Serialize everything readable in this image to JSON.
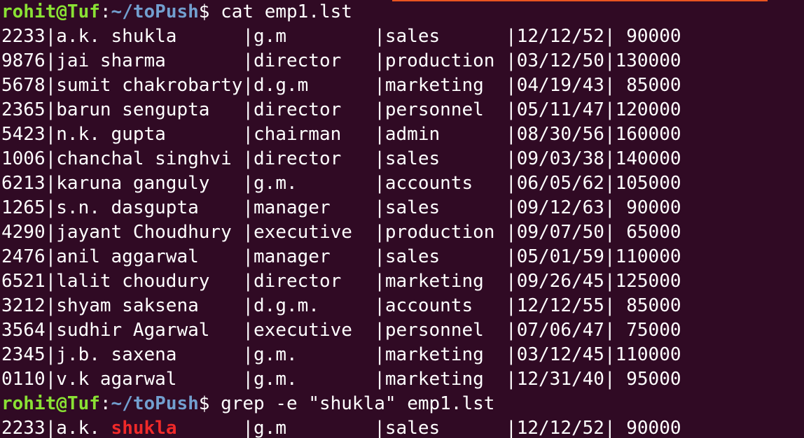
{
  "colors": {
    "background": "#300a24",
    "text": "#ffffff",
    "prompt_user": "#8ae234",
    "prompt_path": "#729fcf",
    "grep_match": "#ef2929",
    "top_accent": "#e95420"
  },
  "prompt": {
    "user_host": "rohit@Tuf",
    "separator": ":",
    "path": "~/toPush",
    "symbol": "$"
  },
  "commands": {
    "cat": " cat emp1.lst",
    "grep": " grep -e \"shukla\" emp1.lst"
  },
  "rows": [
    "2233|a.k. shukla      |g.m        |sales      |12/12/52| 90000",
    "9876|jai sharma       |director   |production |03/12/50|130000",
    "5678|sumit chakrobarty|d.g.m      |marketing  |04/19/43| 85000",
    "2365|barun sengupta   |director   |personnel  |05/11/47|120000",
    "5423|n.k. gupta       |chairman   |admin      |08/30/56|160000",
    "1006|chanchal singhvi |director   |sales      |09/03/38|140000",
    "6213|karuna ganguly   |g.m.       |accounts   |06/05/62|105000",
    "1265|s.n. dasgupta    |manager    |sales      |09/12/63| 90000",
    "4290|jayant Choudhury |executive  |production |09/07/50| 65000",
    "2476|anil aggarwal    |manager    |sales      |05/01/59|110000",
    "6521|lalit choudury   |director   |marketing  |09/26/45|125000",
    "3212|shyam saksena    |d.g.m.     |accounts   |12/12/55| 85000",
    "3564|sudhir Agarwal   |executive  |personnel  |07/06/47| 75000",
    "2345|j.b. saxena      |g.m.       |marketing  |03/12/45|110000",
    "0110|v.k agarwal      |g.m.       |marketing  |12/31/40| 95000"
  ],
  "grep_result": {
    "prefix": "2233|a.k. ",
    "match": "shukla",
    "suffix": "      |g.m        |sales      |12/12/52| 90000"
  }
}
